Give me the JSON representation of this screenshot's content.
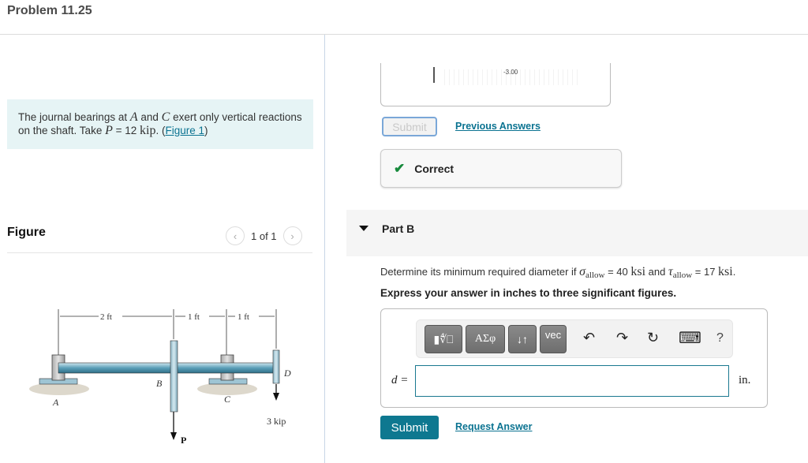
{
  "header": {
    "title": "Problem 11.25"
  },
  "problem": {
    "text_1": "The journal bearings at ",
    "var_A": "A",
    "text_2": " and ",
    "var_C": "C",
    "text_3": " exert only vertical reactions on the shaft. Take ",
    "var_P": "P",
    "text_4": " = 12 ",
    "unit_kip": "kip",
    "text_5": ". (",
    "figure_link": "Figure 1",
    "text_6": ")"
  },
  "figure": {
    "title": "Figure",
    "pager": "1 of 1",
    "prev_icon": "‹",
    "next_icon": "›",
    "dims": [
      "2 ft",
      "1 ft",
      "1 ft"
    ],
    "labels": {
      "A": "A",
      "B": "B",
      "C": "C",
      "D": "D",
      "P": "P",
      "load": "3 kip"
    }
  },
  "part_a": {
    "previous_value": "-3.00",
    "submit_label": "Submit",
    "previous_answers_label": "Previous Answers",
    "feedback": {
      "icon": "✔",
      "label": "Correct",
      "color": "#178a3c"
    }
  },
  "part_b": {
    "header": "Part B",
    "question_pre": "Determine its minimum required diameter if ",
    "sigma": "σ",
    "tau": "τ",
    "sub_allow": "allow",
    "sigma_value": " = 40 ",
    "tau_value": " = 17 ",
    "unit_ksi": "ksi",
    "and": " and ",
    "period": ".",
    "instruction": "Express your answer in inches to three significant figures.",
    "toolbar": {
      "templates_label": "▮∜⎕",
      "greek_label": "ΑΣφ",
      "arrows_label": "↓↑",
      "vec_label": "vec",
      "undo_icon": "↶",
      "redo_icon": "↷",
      "reset_icon": "↻",
      "keyboard_icon": "⌨",
      "help_icon": "?"
    },
    "answer_var": "d =",
    "answer_value": "",
    "answer_unit": "in.",
    "submit_label": "Submit",
    "request_answer_label": "Request Answer"
  }
}
